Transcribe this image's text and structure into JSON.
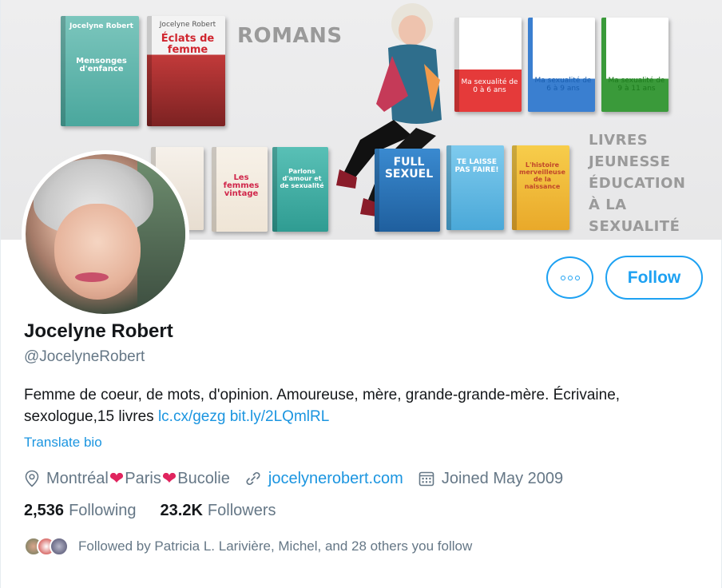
{
  "banner": {
    "word_romans": "ROMANS",
    "word_jeunesse": [
      "LIVRES",
      "JEUNESSE",
      "ÉDUCATION",
      "À LA",
      "SEXUALITÉ"
    ],
    "books": [
      {
        "title": "Mensonges d'enfance",
        "author": "Jocelyne Robert",
        "color": "#5fb8b0"
      },
      {
        "title": "Éclats de femme",
        "author": "Jocelyne Robert",
        "color": "#d83a3a"
      },
      {
        "title": "Ma sexualité de 0 à 6 ans",
        "color": "#e53a3a"
      },
      {
        "title": "Ma sexualité de 6 à 9 ans",
        "color": "#ffffff"
      },
      {
        "title": "Ma sexualité de 9 à 11 ans",
        "color": "#ffffff"
      },
      {
        "title": "Les femmes vintage",
        "author": "Jocelyne Robert",
        "color": "#f4ede4"
      },
      {
        "title": "Parlons d'amour et de sexualité",
        "color": "#4fbab0"
      },
      {
        "title": "FULL SEXUEL",
        "color": "#2a7ac0"
      },
      {
        "title": "TE LAISSE PAS FAIRE!",
        "color": "#6cc1e8"
      },
      {
        "title": "L'histoire merveilleuse de la naissance",
        "color": "#f3c23c"
      }
    ]
  },
  "profile": {
    "name": "Jocelyne Robert",
    "handle": "@JocelyneRobert",
    "bio_text": "Femme de coeur, de mots, d'opinion. Amoureuse, mère, grande-grande-mère. Écrivaine, sexologue,15 livres ",
    "bio_link1": "lc.cx/gezg",
    "bio_link2": "bit.ly/2LQmlRL",
    "translate": "Translate bio"
  },
  "buttons": {
    "follow": "Follow",
    "more_icon": "more-horizontal-icon"
  },
  "meta": {
    "location_part1": "Montréal",
    "location_part2": "Paris",
    "location_part3": "Bucolie",
    "heart": "❤",
    "website": "jocelynerobert.com",
    "joined": "Joined May 2009"
  },
  "stats": {
    "following_count": "2,536",
    "following_label": "Following",
    "followers_count": "23.2K",
    "followers_label": "Followers"
  },
  "followed_by": "Followed by Patricia L. Larivière, Michel, and 28 others you follow",
  "colors": {
    "accent": "#1da1f2",
    "link": "#1b95e0",
    "muted": "#657786",
    "heart": "#e0245e"
  }
}
